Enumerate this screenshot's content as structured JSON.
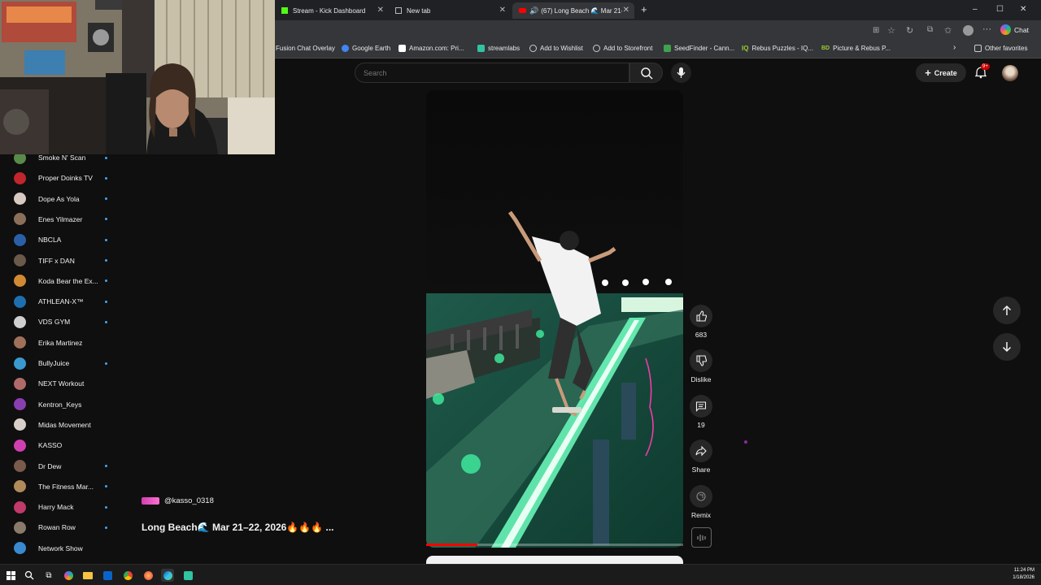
{
  "tabs": [
    {
      "title": "Stream - Kick Dashboard"
    },
    {
      "title": "New tab"
    },
    {
      "title": "(67) Long Beach 🌊 Mar 21–2..."
    }
  ],
  "bookmarks": [
    {
      "label": "Fusion Chat Overlay"
    },
    {
      "label": "Google Earth"
    },
    {
      "label": "Amazon.com: Pri..."
    },
    {
      "label": "streamlabs"
    },
    {
      "label": "Add to Wishlist"
    },
    {
      "label": "Add to Storefront"
    },
    {
      "label": "SeedFinder - Cann..."
    },
    {
      "label": "Rebus Puzzles - IQ..."
    },
    {
      "label": "Picture & Rebus P..."
    },
    {
      "label": "Other favorites"
    }
  ],
  "toolbar": {
    "chat_label": "Chat"
  },
  "header": {
    "search_placeholder": "Search",
    "create_label": "Create",
    "notif_badge": "9+"
  },
  "subscriptions": [
    {
      "name": "Smoke N' Scan",
      "dot": true,
      "color": "#5a8a4a"
    },
    {
      "name": "Proper Doinks TV",
      "dot": true,
      "color": "#c0262c"
    },
    {
      "name": "Dope As Yola",
      "dot": true,
      "color": "#d8c9c2"
    },
    {
      "name": "Enes Yilmazer",
      "dot": true,
      "color": "#8b6f5a"
    },
    {
      "name": "NBCLA",
      "dot": true,
      "color": "#2a5fa8"
    },
    {
      "name": "TIFF x DAN",
      "dot": true,
      "color": "#6b5a4a"
    },
    {
      "name": "Koda Bear the Ex...",
      "dot": true,
      "color": "#d18a32"
    },
    {
      "name": "ATHLEAN-X™",
      "dot": true,
      "color": "#1e6fb0"
    },
    {
      "name": "VDS GYM",
      "dot": true,
      "color": "#cfcfcf"
    },
    {
      "name": "Erika Martinez",
      "dot": false,
      "color": "#a0705a"
    },
    {
      "name": "BullyJuice",
      "dot": true,
      "color": "#3a9ad0"
    },
    {
      "name": "NEXT Workout",
      "dot": false,
      "color": "#b06a6a"
    },
    {
      "name": "Kentron_Keys",
      "dot": false,
      "color": "#8a3fb0"
    },
    {
      "name": "Midas Movement",
      "dot": false,
      "color": "#d8d0c8"
    },
    {
      "name": "KASSO",
      "dot": false,
      "color": "#d03fb0"
    },
    {
      "name": "Dr Dew",
      "dot": true,
      "color": "#7a5a4a"
    },
    {
      "name": "The Fitness Mar...",
      "dot": true,
      "color": "#b08a5a"
    },
    {
      "name": "Harry Mack",
      "dot": true,
      "color": "#c03a6a"
    },
    {
      "name": "Rowan Row",
      "dot": true,
      "color": "#8a7a6a"
    },
    {
      "name": "Network Show",
      "dot": false,
      "color": "#3a8ad0"
    }
  ],
  "video": {
    "channel": "@kasso_0318",
    "title": "Long Beach🌊 Mar 21–22, 2026🔥🔥🔥 ...",
    "progress": 0.2
  },
  "actions": {
    "like_count": "683",
    "dislike_label": "Dislike",
    "comment_count": "19",
    "share_label": "Share",
    "remix_label": "Remix"
  },
  "taskbar": {
    "time": "11:24 PM",
    "date": "1/18/2026"
  },
  "colors": {
    "accent_red": "#ff0000",
    "link_blue": "#3ea6ff",
    "bg": "#0f0f0f"
  }
}
